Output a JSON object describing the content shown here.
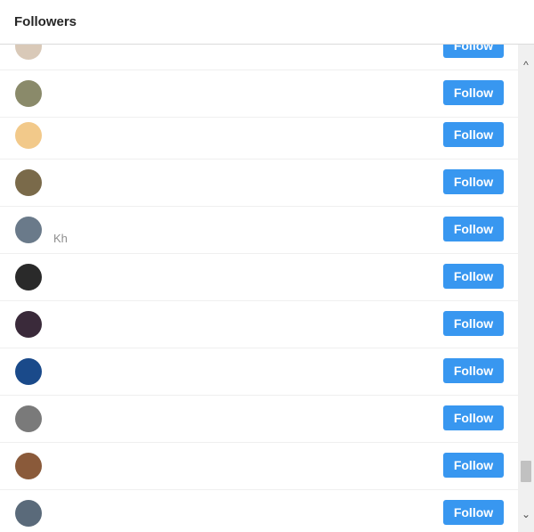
{
  "header": {
    "title": "Followers"
  },
  "followers": [
    {
      "name": "",
      "sub": "",
      "button": "Follow",
      "avatar_color": "#d9c9b8"
    },
    {
      "name": "",
      "sub": "",
      "button": "Follow",
      "avatar_color": "#8a8a6a"
    },
    {
      "name": "",
      "sub": "",
      "button": "Follow",
      "avatar_color": "#f2c98a"
    },
    {
      "name": "",
      "sub": "",
      "button": "Follow",
      "avatar_color": "#7a6a4a"
    },
    {
      "name": "",
      "sub": "Kh",
      "button": "Follow",
      "avatar_color": "#6a7a8a"
    },
    {
      "name": "",
      "sub": "",
      "button": "Follow",
      "avatar_color": "#2a2a2a"
    },
    {
      "name": "",
      "sub": "",
      "button": "Follow",
      "avatar_color": "#3a2a3a"
    },
    {
      "name": "",
      "sub": "",
      "button": "Follow",
      "avatar_color": "#1a4a8a"
    },
    {
      "name": "",
      "sub": "",
      "button": "Follow",
      "avatar_color": "#7a7a7a"
    },
    {
      "name": "",
      "sub": "",
      "button": "Follow",
      "avatar_color": "#8a5a3a"
    },
    {
      "name": "",
      "sub": "",
      "button": "Follow",
      "avatar_color": "#5a6a7a"
    }
  ],
  "scrollbar": {
    "up_icon": "chevron-up-icon",
    "down_icon": "chevron-down-icon"
  }
}
